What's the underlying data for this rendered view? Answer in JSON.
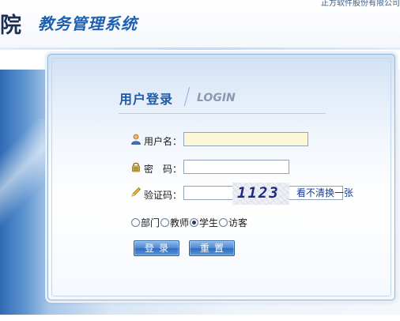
{
  "header": {
    "school_char": "院",
    "system_title": "教务管理系统",
    "vendor": "正方软件股份有限公司"
  },
  "login": {
    "title": "用户登录",
    "subtitle": "LOGIN",
    "username_label": "用户名：",
    "password_label": "密　码：",
    "captcha_label": "验证码：",
    "username_value": "",
    "password_value": "",
    "captcha_value": "",
    "captcha_image_text": "1123",
    "refresh_link": "看不清换一张",
    "roles": [
      {
        "label": "部门",
        "selected": false
      },
      {
        "label": "教师",
        "selected": false
      },
      {
        "label": "学生",
        "selected": true
      },
      {
        "label": "访客",
        "selected": false
      }
    ],
    "login_button": "登录",
    "reset_button": "重置"
  },
  "colors": {
    "title_blue": "#1f5fb0",
    "button_blue": "#4f8ad3",
    "link_blue": "#123b9a"
  }
}
